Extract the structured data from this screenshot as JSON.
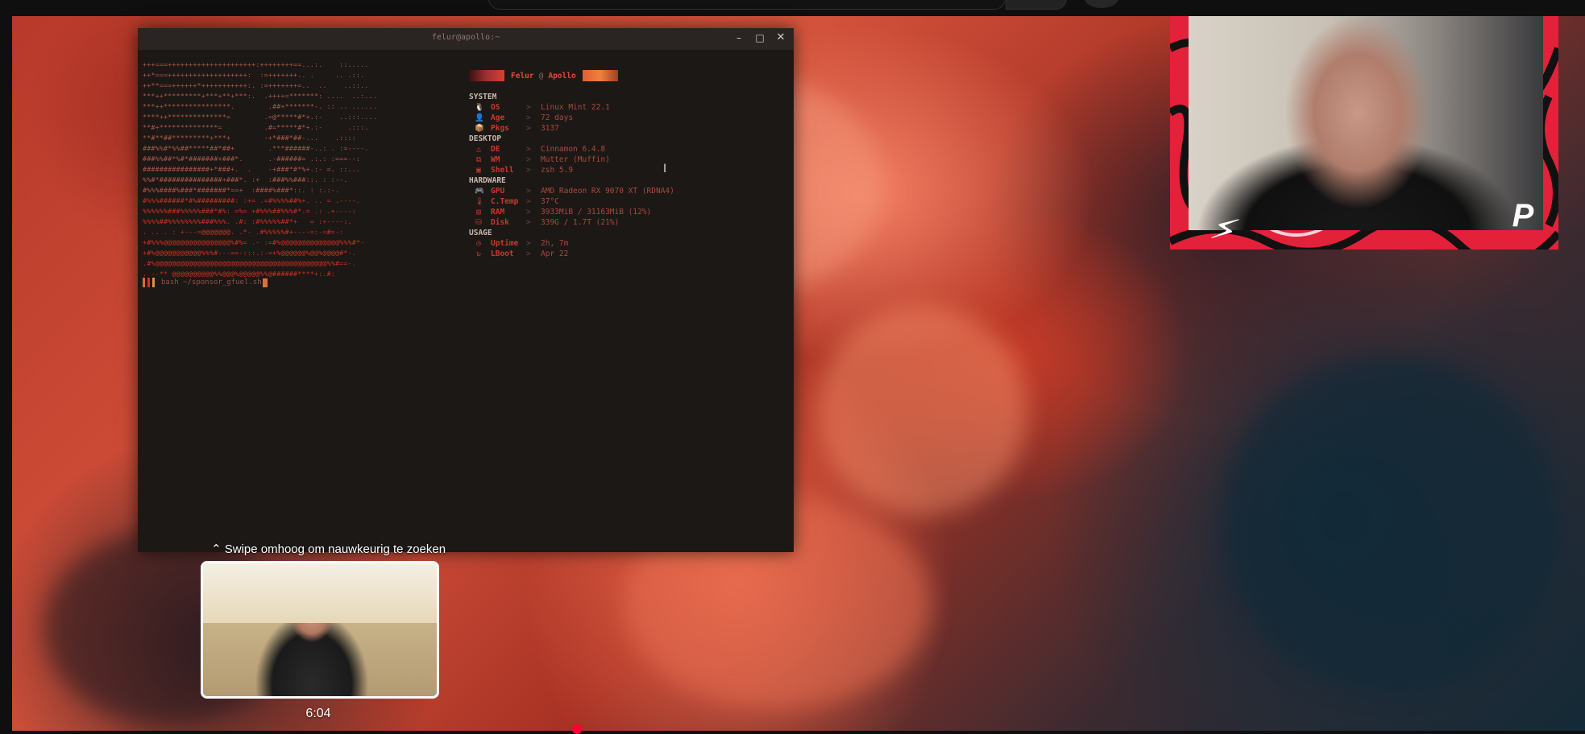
{
  "colors": {
    "accent": "#ff0033",
    "terminal_bg": "#1c1816",
    "ascii_red": "#d03020",
    "fetch_label": "#c63a2c",
    "facecam_border": "#e4213a"
  },
  "terminal": {
    "title": "felur@apollo:~",
    "window_buttons": [
      "–",
      "□",
      "✕"
    ],
    "ascii_art": [
      "+++===+++++++++++++++++++++:++++++++==...:.    ::.....",
      "++*===+++++++++++++++++++:  :=+++++++.. .     .. .::.",
      "++**===++++++*+++++++++++:. :=+++++++=..  ..    ..::..",
      "***++*********+***+**+***:.  .++++=*******: ....  ..:...",
      "***++****************.        .##+*******-. :: .. ......",
      "****++**************=        .=@*****#*+.:-    ..:::....",
      "**#+**************=          .#=*****#*+.:-      .:::.",
      "**#**##*********+***+        -+*###*##-...    .::::",
      "###%%#*%%##*****##*##+        .***######-..: . :=----.",
      "###%%##*%#*#######+###*.      .-######= .:.: :===--:",
      "################+*###+.  .    -+###*#*%+.:- =. ::...",
      "%%#*###############+###*. :+  :###%%###::. : :--.",
      "#%%%####%###*#######*==+  :####%###*::. : :.:-.",
      "#%%%######*#%#########: :+= .=#%%%%##%+. .. = .----.",
      "%%%%%%###%%%%%###*#%: =%= +#%%%##%%%#*.= .: .+----:",
      "%%%%##%%%%%%%%###%%%. .#: :#%%%%%##*+   = :+----:.",
      ". .. . : +---=@@@@@@@. .*- .#%%%%%#+----=:-=#=-:",
      "+#%%%@@@@@@@@@@@@@@@@%#%= .- :=#%@@@@@@@@@@@@@@%%%#*-",
      "+#%@@@@@@@@@@@%%%#---==-:::.:-=+%@@@@@@%@@%@@@@#*-.",
      ".#%@@@@@@@@@@@@@@@@@@@@@@@@@@@@@@@@@@@@@@@@@%%#==-.",
      ". --** @@@@@@@@@@%%@@@%@@@@@%%@######****+:.#:"
    ],
    "prompt": "bash ~/sponsor_gfuel.sh",
    "prompt_bar_colors": [
      "#e06a30",
      "#c83828",
      "#e09040"
    ],
    "fetch": {
      "user": "Felur",
      "at": "@",
      "host": "Apollo",
      "sections": [
        {
          "name": "SYSTEM",
          "rows": [
            {
              "icon": "🐧",
              "key": "OS",
              "value": "Linux Mint 22.1"
            },
            {
              "icon": "👤",
              "key": "Age",
              "value": "72 days"
            },
            {
              "icon": "📦",
              "key": "Pkgs",
              "value": "3137"
            }
          ]
        },
        {
          "name": "DESKTOP",
          "rows": [
            {
              "icon": "△",
              "key": "DE",
              "value": "Cinnamon 6.4.8"
            },
            {
              "icon": "⧉",
              "key": "WM",
              "value": "Mutter (Muffin)"
            },
            {
              "icon": "▣",
              "key": "Shell",
              "value": "zsh 5.9"
            }
          ]
        },
        {
          "name": "HARDWARE",
          "rows": [
            {
              "icon": "🎮",
              "key": "GPU",
              "value": "AMD Radeon RX 9070 XT (RDNA4)"
            },
            {
              "icon": "🌡",
              "key": "C.Temp",
              "value": "37°C"
            },
            {
              "icon": "▤",
              "key": "RAM",
              "value": "3933MiB / 31163MiB (12%)"
            },
            {
              "icon": "⛁",
              "key": "Disk",
              "value": "339G / 1.7T (21%)"
            }
          ]
        },
        {
          "name": "USAGE",
          "rows": [
            {
              "icon": "◷",
              "key": "Uptime",
              "value": "2h, 7m"
            },
            {
              "icon": "↻",
              "key": "LBoot",
              "value": "Apr 22"
            }
          ]
        }
      ],
      "arrow": ">"
    }
  },
  "seek": {
    "hint": "⌃ Swipe omhoog om nauwkeurig te zoeken",
    "time": "6:04"
  }
}
